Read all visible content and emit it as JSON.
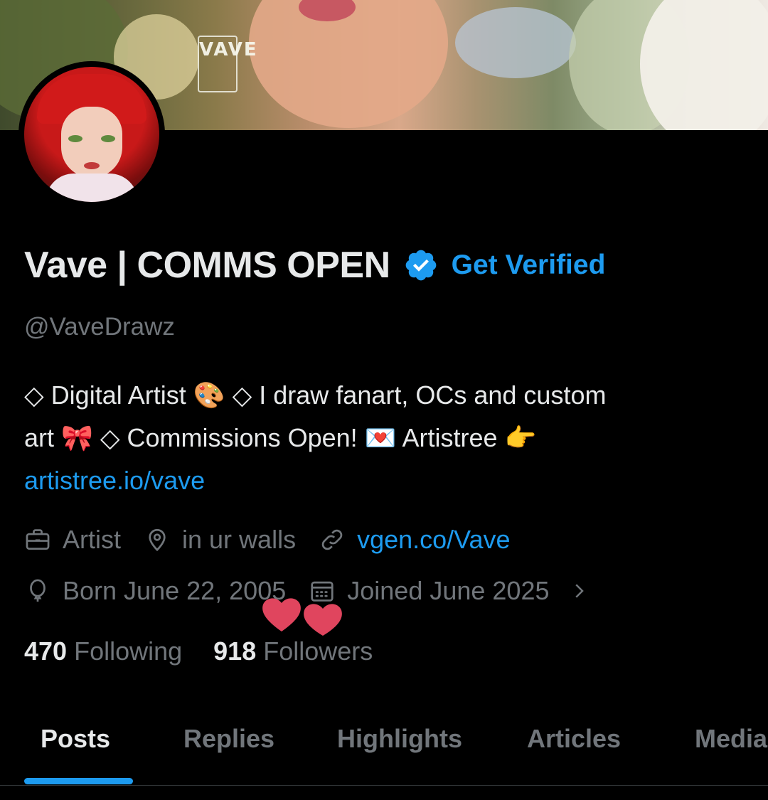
{
  "profile": {
    "display_name": "Vave | COMMS OPEN",
    "get_verified_label": "Get Verified",
    "handle": "@VaveDrawz",
    "banner_watermark": "VAVE",
    "bio": {
      "line1": "◇ Digital Artist 🎨  ◇ I draw fanart, OCs and custom",
      "line2": "art 🎀 ◇ Commissions Open! 💌 Artistree 👉",
      "link": "artistree.io/vave"
    },
    "meta": {
      "profession": "Artist",
      "location": "in ur walls",
      "website": "vgen.co/Vave",
      "birthday": "Born June 22, 2005",
      "joined": "Joined June 2025"
    },
    "stats": {
      "following_count": "470",
      "following_label": "Following",
      "followers_count": "918",
      "followers_label": "Followers"
    }
  },
  "tabs": [
    {
      "label": "Posts",
      "active": true
    },
    {
      "label": "Replies",
      "active": false
    },
    {
      "label": "Highlights",
      "active": false
    },
    {
      "label": "Articles",
      "active": false
    },
    {
      "label": "Media",
      "active": false
    }
  ],
  "colors": {
    "accent": "#1d9bf0",
    "text_primary": "#e7e9ea",
    "text_secondary": "#71767b",
    "background": "#000000",
    "heart": "#e0455e"
  },
  "icons": [
    "verified-badge-icon",
    "briefcase-icon",
    "location-pin-icon",
    "link-icon",
    "balloon-icon",
    "calendar-icon",
    "chevron-right-icon",
    "hearts-sticker-icon"
  ]
}
